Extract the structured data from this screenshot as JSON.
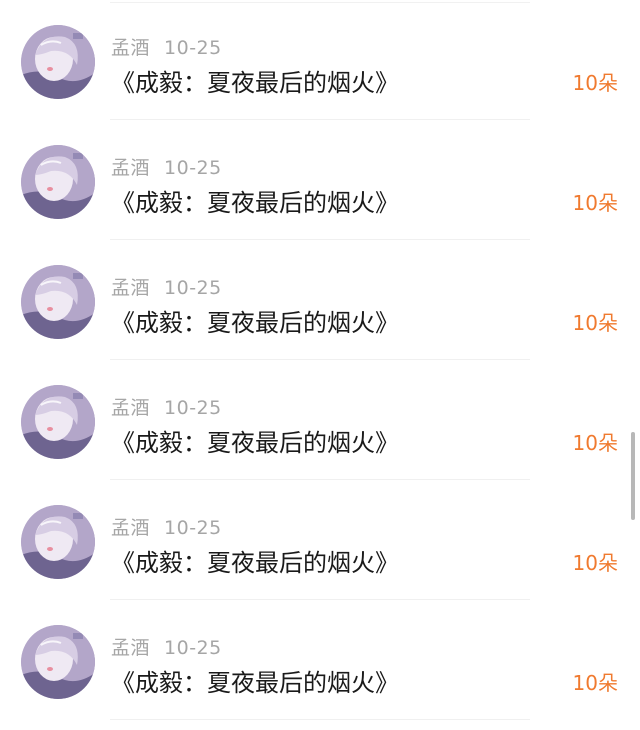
{
  "list": {
    "items": [
      {
        "user": "孟酒",
        "date": "10-25",
        "title": "《成毅：夏夜最后的烟火》",
        "count": "10朵"
      },
      {
        "user": "孟酒",
        "date": "10-25",
        "title": "《成毅：夏夜最后的烟火》",
        "count": "10朵"
      },
      {
        "user": "孟酒",
        "date": "10-25",
        "title": "《成毅：夏夜最后的烟火》",
        "count": "10朵"
      },
      {
        "user": "孟酒",
        "date": "10-25",
        "title": "《成毅：夏夜最后的烟火》",
        "count": "10朵"
      },
      {
        "user": "孟酒",
        "date": "10-25",
        "title": "《成毅：夏夜最后的烟火》",
        "count": "10朵"
      },
      {
        "user": "孟酒",
        "date": "10-25",
        "title": "《成毅：夏夜最后的烟火》",
        "count": "10朵"
      }
    ]
  },
  "colors": {
    "username": "#a6a6a6",
    "title": "#1a1a1a",
    "count_accent": "#f07a2f"
  },
  "icons": {
    "avatar": "avatar-photo"
  }
}
